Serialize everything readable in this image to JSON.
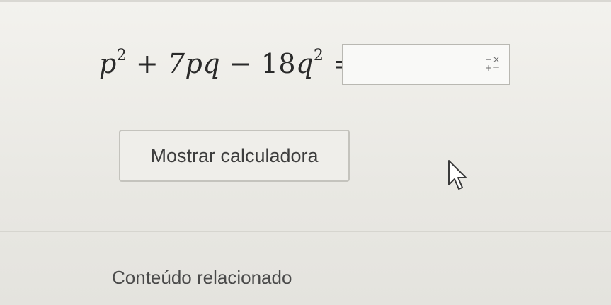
{
  "problem": {
    "equation_parts": {
      "term1_var": "p",
      "term1_exp": "2",
      "op1": "+",
      "term2": "7pq",
      "op2": "−",
      "term3_coef": "18",
      "term3_var": "q",
      "term3_exp": "2",
      "equals": "="
    },
    "answer_value": "",
    "answer_placeholder": "",
    "keypad_icon": "math-keypad-icon",
    "keypad_row1": "−×",
    "keypad_row2": "+="
  },
  "calculator": {
    "button_label": "Mostrar calculadora"
  },
  "related": {
    "title": "Conteúdo relacionado"
  },
  "cursor": {
    "icon": "mouse-pointer-icon"
  }
}
